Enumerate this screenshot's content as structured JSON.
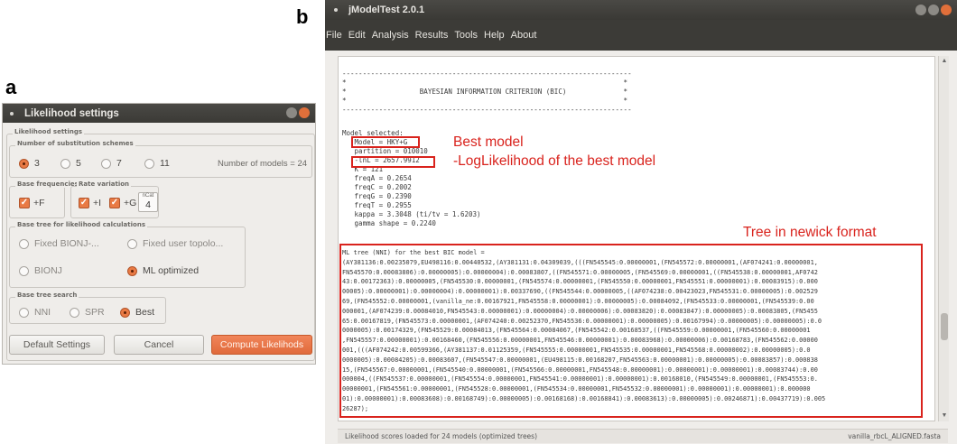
{
  "panel_a": {
    "letter": "a",
    "title": "Likelihood settings",
    "section_title": "Likelihood settings",
    "schemes": {
      "legend": "Number of substitution schemes",
      "options": [
        "3",
        "5",
        "7",
        "11"
      ],
      "selected": "3",
      "models_label": "Number of models = 24"
    },
    "base_freq": {
      "legend": "Base frequencies",
      "label": "+F"
    },
    "rate_var": {
      "legend": "Rate variation",
      "inv_label": "+I",
      "gamma_label": "+G",
      "ncat_label": "nCat",
      "ncat_value": "4"
    },
    "base_tree": {
      "legend": "Base tree for likelihood calculations",
      "opt1": "Fixed BIONJ-...",
      "opt2": "Fixed user topolo...",
      "opt3": "BIONJ",
      "opt4": "ML optimized"
    },
    "tree_search": {
      "legend": "Base tree search",
      "opt1": "NNI",
      "opt2": "SPR",
      "opt3": "Best"
    },
    "buttons": {
      "default": "Default Settings",
      "cancel": "Cancel",
      "compute": "Compute Likelihods"
    }
  },
  "panel_b": {
    "letter": "b",
    "title": "jModelTest 2.0.1",
    "menu": [
      "File",
      "Edit",
      "Analysis",
      "Results",
      "Tools",
      "Help",
      "About"
    ],
    "bic_header": {
      "dots": "-----------------------------------------------------------------------",
      "star_line": "*                                                                    *",
      "title_line": "*                  BAYESIAN INFORMATION CRITERION (BIC)              *"
    },
    "model_selected": "Model selected:",
    "model_lines": [
      "   Model = HKY+G",
      "   partition = 010010",
      "   -lnL = 2657.9912",
      "   K = 121",
      "   freqA = 0.2654",
      "   freqC = 0.2002",
      "   freqG = 0.2390",
      "   freqT = 0.2955",
      "   kappa = 3.3048 (ti/tv = 1.6203)",
      "   gamma shape = 0.2240"
    ],
    "tree_lines": [
      "ML tree (NNI) for the best BIC model =",
      "(AY381136:0.00235079,EU498116:0.00440532,(AY381131:0.04309039,(((FN545545:0.00000001,(FN545572:0.00000001,(AF074241:0.00000001,",
      "FN545570:0.00083806):0.00000005):0.00000004):0.00083807,((FN545571:0.00000005,(FN545569:0.00000001,((FN545538:0.00000001,AF0742",
      "43:0.00172363):0.00000005,(FN545530:0.00000001,(FN545574:0.00000001,(FN545550:0.00000001,FN545551:0.00000001):0.00083915):0.000",
      "00005):0.00000001):0.00000004):0.00000001):0.00337690,((FN545544:0.00000005,((AF074238:0.00423023,FN545531:0.00000005):0.002529",
      "69,(FN545552:0.00000001,(vanilla_ne:0.00167921,FN545558:0.00000001):0.00000005):0.00084092,(FN545533:0.00000001,(FN545539:0.00",
      "000001,(AF074239:0.00084010,FN545543:0.00000001):0.00000004):0.00000006):0.00083820):0.00083847):0.00000005):0.00083805,(FN5455",
      "65:0.00167819,(FN545573:0.00000001,(AF074240:0.00252370,FN545536:0.00000001):0.00000005):0.00167994):0.00000005):0.00000005):0.0",
      "0000005):0.00174329,(FN545529:0.00084013,(FN545564:0.00084067,(FN545542:0.00168537,((FN545559:0.00000001,(FN545560:0.00000001",
      ",FN545557:0.00000001):0.00168460,(FN545556:0.00000001,FN545546:0.00000001):0.00083968):0.00000006):0.00168783,(FN545562:0.00000",
      "001,(((AF074242:0.00599366,(AY381137:0.01125359,(FN545555:0.00000001,FN545535:0.00000001,FN545568:0.00000002):0.00000005):0.0",
      "0000005):0.00084205):0.00083607,(FN545547:0.00000001,(EU498115:0.00168207,FN545563:0.00000001):0.00000005):0.00083857):0.000838",
      "15,(FN545567:0.00000001,(FN545540:0.00000001,(FN545566:0.00000001,FN545548:0.00000001):0.00000001):0.00000001):0.00083744):0.00",
      "000004,((FN545537:0.00000001,(FN545554:0.00000001,FN545541:0.00000001):0.00000001):0.00168010,(FN545549:0.00000001,(FN545553:0.",
      "00000001,(FN545561:0.00000001,(FN545528:0.00000001,(FN545534:0.00000001,FN545532:0.00000001):0.00000001):0.00000001):0.000000",
      "01):0.00000001):0.00083608):0.00168749):0.00000005):0.00168168):0.00168841):0.00083613):0.00000005):0.00246871):0.00437719):0.005",
      "26287);"
    ],
    "annotations": {
      "best_model": "Best model",
      "loglik": "-LogLikelihood of the best model",
      "tree": "Tree in newick format"
    },
    "status": {
      "left": "Likelihood scores loaded for 24 models (optimized trees)",
      "right": "vanilla_rbcL_ALIGNED.fasta"
    }
  },
  "colors": {
    "accent": "#e97a44",
    "annotation": "#d9231d",
    "titlebar": "#3c3b37"
  }
}
